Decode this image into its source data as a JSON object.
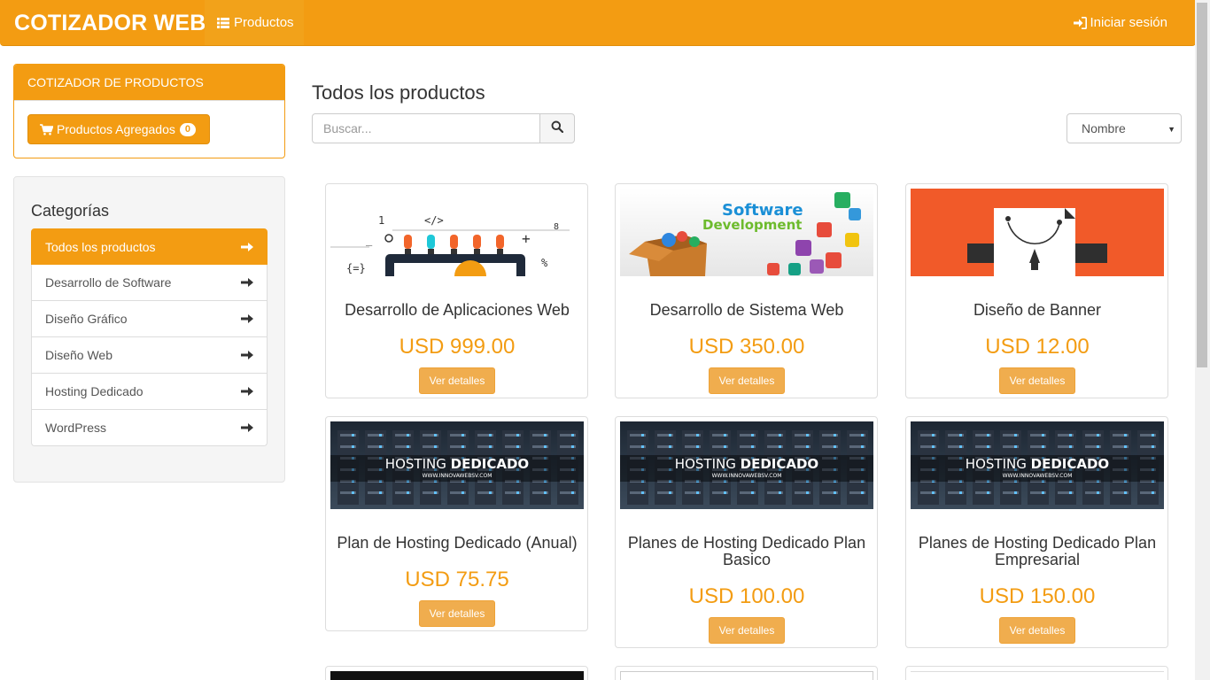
{
  "navbar": {
    "brand": "COTIZADOR WEB",
    "products_label": "Productos",
    "login_label": "Iniciar sesión"
  },
  "cotizador": {
    "title": "COTIZADOR DE PRODUCTOS",
    "added_label": "Productos Agregados",
    "added_count": "0"
  },
  "categories": {
    "title": "Categorías",
    "items": [
      {
        "label": "Todos los productos",
        "active": true
      },
      {
        "label": "Desarrollo de Software",
        "active": false
      },
      {
        "label": "Diseño Gráfico",
        "active": false
      },
      {
        "label": "Diseño Web",
        "active": false
      },
      {
        "label": "Hosting Dedicado",
        "active": false
      },
      {
        "label": "WordPress",
        "active": false
      }
    ]
  },
  "main": {
    "title": "Todos los productos",
    "search_placeholder": "Buscar...",
    "sort_selected": "Nombre"
  },
  "products": [
    {
      "name": "Desarrollo de Aplicaciones Web",
      "price": "USD 999.00",
      "button": "Ver detalles",
      "image": "web-apps"
    },
    {
      "name": "Desarrollo de Sistema Web",
      "price": "USD 350.00",
      "button": "Ver detalles",
      "image": "software-development",
      "image_text_1": "Software",
      "image_text_2": "Development"
    },
    {
      "name": "Diseño de Banner",
      "price": "USD 12.00",
      "button": "Ver detalles",
      "image": "bezier-design"
    },
    {
      "name": "Plan de Hosting Dedicado (Anual)",
      "price": "USD 75.75",
      "button": "Ver detalles",
      "image": "hosting",
      "image_title_light": "HOSTING",
      "image_title_bold": "DEDICADO",
      "image_sub": "WWW.INNOVAWEBSV.COM"
    },
    {
      "name": "Planes de Hosting Dedicado Plan Basico",
      "price": "USD 100.00",
      "button": "Ver detalles",
      "image": "hosting",
      "image_title_light": "HOSTING",
      "image_title_bold": "DEDICADO",
      "image_sub": "WWW.INNOVAWEBSV.COM"
    },
    {
      "name": "Planes de Hosting Dedicado Plan Empresarial",
      "price": "USD 150.00",
      "button": "Ver detalles",
      "image": "hosting",
      "image_title_light": "HOSTING",
      "image_title_bold": "DEDICADO",
      "image_sub": "WWW.INNOVAWEBSV.COM"
    }
  ],
  "colors": {
    "brand": "#f39c12",
    "button": "#f0ad4e"
  }
}
